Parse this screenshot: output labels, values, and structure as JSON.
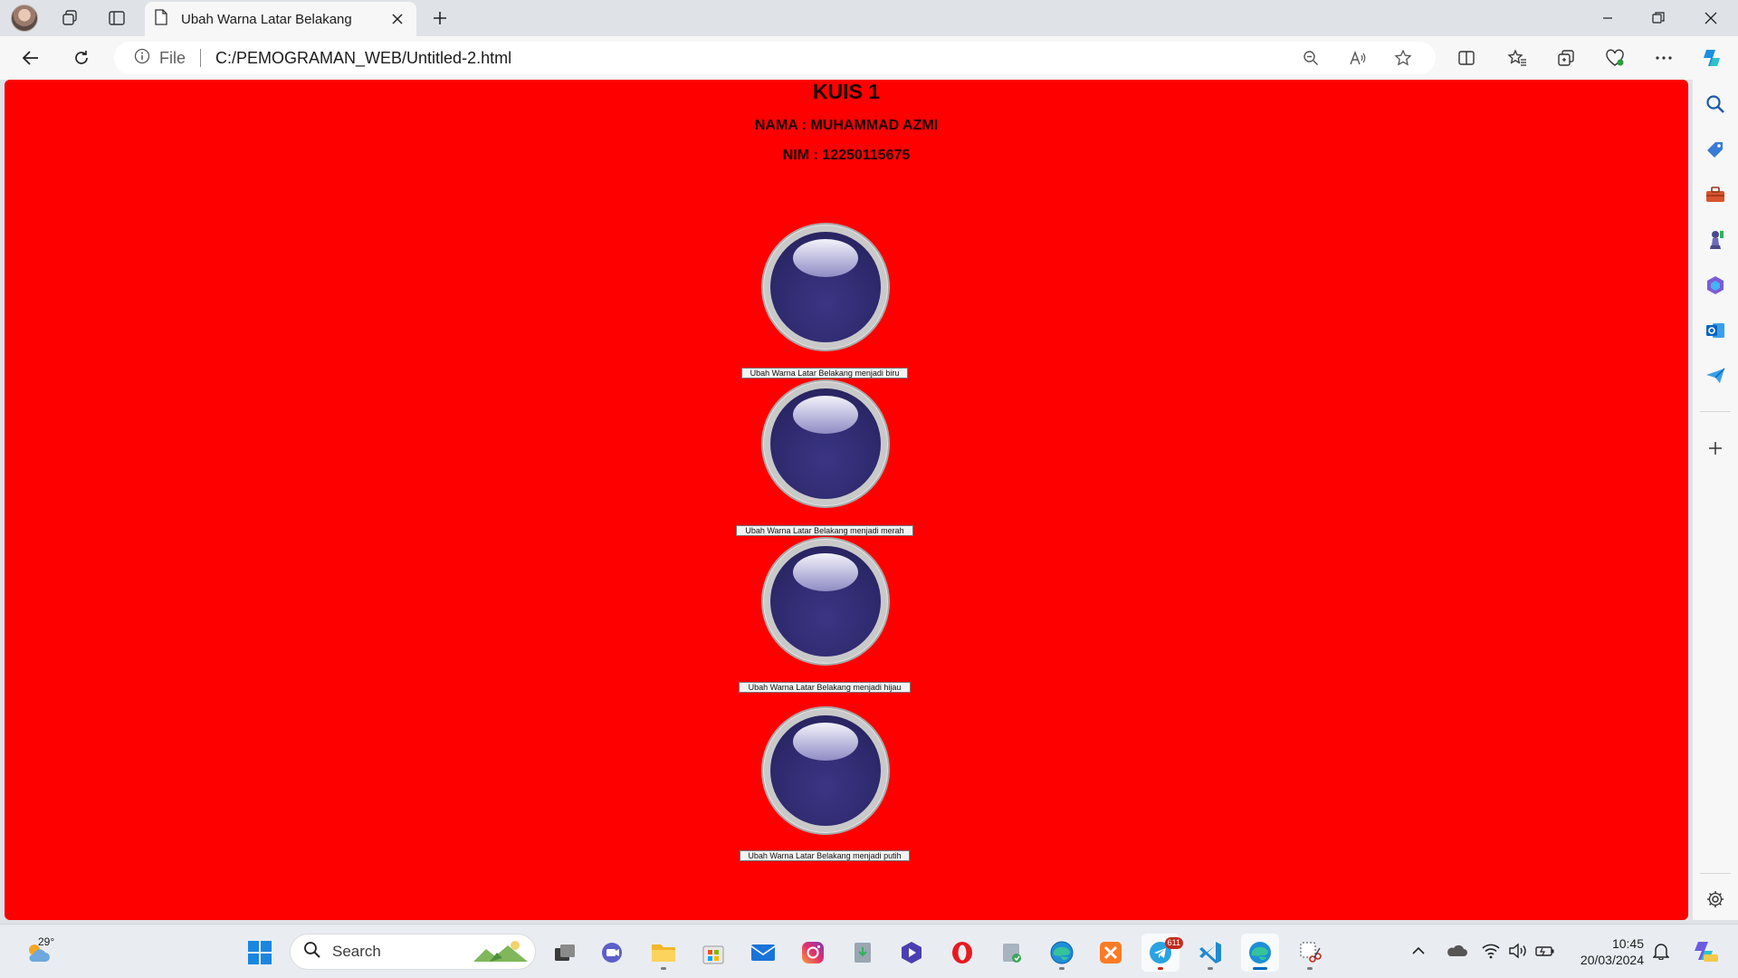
{
  "browser": {
    "tab_title": "Ubah Warna Latar Belakang",
    "address": {
      "scheme_label": "File",
      "url": "C:/PEMOGRAMAN_WEB/Untitled-2.html"
    }
  },
  "page": {
    "background_color": "#ff0000",
    "heading": "KUIS 1",
    "nama": "NAMA : MUHAMMAD AZMI",
    "nim": "NIM : 12250115675",
    "buttons": [
      {
        "label": "Ubah Warna Latar Belakang menjadi biru"
      },
      {
        "label": "Ubah Warna Latar Belakang menjadi merah"
      },
      {
        "label": "Ubah Warna Latar Belakang menjadi hijau"
      },
      {
        "label": "Ubah Warna Latar Belakang menjadi putih"
      }
    ]
  },
  "sidebar": {
    "icons": [
      "search-icon",
      "tag-icon",
      "toolbox-icon",
      "chess-icon",
      "copilot-icon",
      "outlook-icon",
      "paper-plane-icon",
      "add-icon",
      "settings-icon"
    ]
  },
  "taskbar": {
    "weather_temp": "29°",
    "search_placeholder": "Search",
    "telegram_badge": "611",
    "time": "10:45",
    "date": "20/03/2024",
    "accent_color": "#0067c0"
  }
}
